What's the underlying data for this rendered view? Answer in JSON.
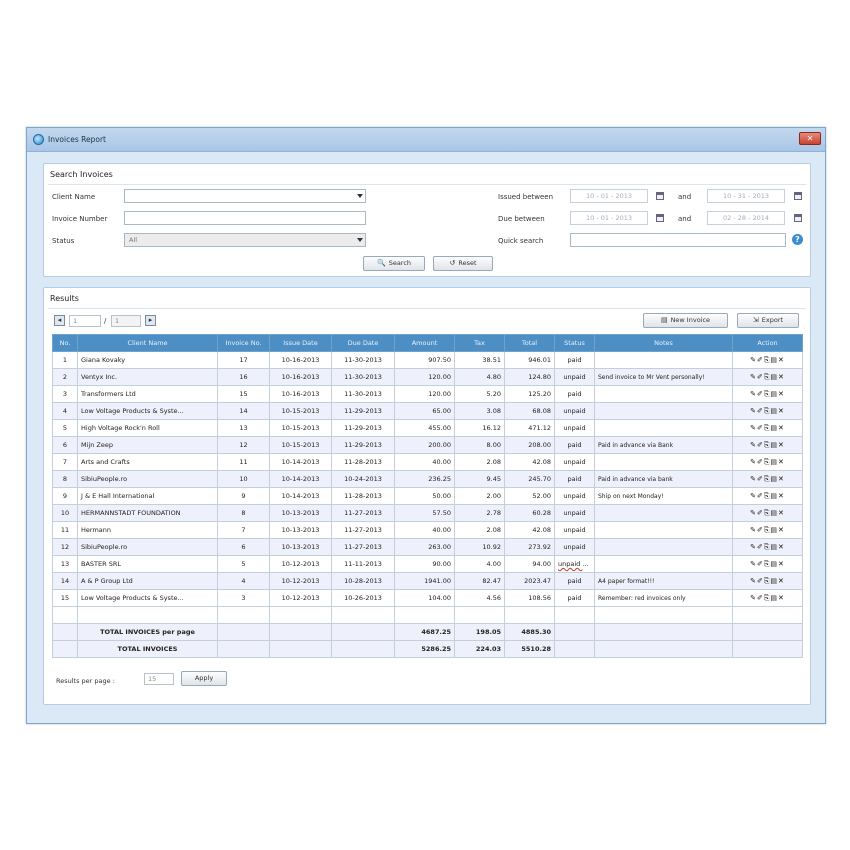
{
  "window": {
    "title": "Invoices Report",
    "close_glyph": "✕"
  },
  "search": {
    "title": "Search Invoices",
    "client_name_label": "Client Name",
    "client_name_value": "",
    "invoice_number_label": "Invoice Number",
    "invoice_number_value": "",
    "status_label": "Status",
    "status_value": "All",
    "issued_between_label": "Issued between",
    "issued_from": "10 - 01 - 2013",
    "issued_to": "10 - 31 - 2013",
    "due_between_label": "Due between",
    "due_from": "10 - 01 - 2013",
    "due_to": "02 - 28 - 2014",
    "and_label": "and",
    "quick_search_label": "Quick search",
    "quick_search_value": "",
    "search_button": "Search",
    "reset_button": "Reset"
  },
  "results": {
    "title": "Results",
    "current_page": "1",
    "total_pages": "1",
    "page_separator": "/",
    "new_invoice_button": "New Invoice",
    "export_button": "Export",
    "columns": [
      "No.",
      "Client Name",
      "Invoice No.",
      "Issue Date",
      "Due Date",
      "Amount",
      "Tax",
      "Total",
      "Status",
      "Notes",
      "Action"
    ],
    "rows": [
      {
        "no": "1",
        "client": "Giana Kovaky",
        "invoice_no": "17",
        "issue_date": "10-16-2013",
        "due_date": "11-30-2013",
        "amount": "907.50",
        "tax": "38.51",
        "total": "946.01",
        "status": "paid",
        "notes": ""
      },
      {
        "no": "2",
        "client": "Ventyx Inc.",
        "invoice_no": "16",
        "issue_date": "10-16-2013",
        "due_date": "11-30-2013",
        "amount": "120.00",
        "tax": "4.80",
        "total": "124.80",
        "status": "unpaid",
        "notes": "Send invoice to Mr Vent personally!"
      },
      {
        "no": "3",
        "client": "Transformers Ltd",
        "invoice_no": "15",
        "issue_date": "10-16-2013",
        "due_date": "11-30-2013",
        "amount": "120.00",
        "tax": "5.20",
        "total": "125.20",
        "status": "paid",
        "notes": ""
      },
      {
        "no": "4",
        "client": "Low Voltage Products & Syste...",
        "invoice_no": "14",
        "issue_date": "10-15-2013",
        "due_date": "11-29-2013",
        "amount": "65.00",
        "tax": "3.08",
        "total": "68.08",
        "status": "unpaid",
        "notes": ""
      },
      {
        "no": "5",
        "client": "High Voltage Rock'n Roll",
        "invoice_no": "13",
        "issue_date": "10-15-2013",
        "due_date": "11-29-2013",
        "amount": "455.00",
        "tax": "16.12",
        "total": "471.12",
        "status": "unpaid",
        "notes": ""
      },
      {
        "no": "6",
        "client": "Mijn Zeep",
        "invoice_no": "12",
        "issue_date": "10-15-2013",
        "due_date": "11-29-2013",
        "amount": "200.00",
        "tax": "8.00",
        "total": "208.00",
        "status": "paid",
        "notes": "Paid in advance via Bank"
      },
      {
        "no": "7",
        "client": "Arts and Crafts",
        "invoice_no": "11",
        "issue_date": "10-14-2013",
        "due_date": "11-28-2013",
        "amount": "40.00",
        "tax": "2.08",
        "total": "42.08",
        "status": "unpaid",
        "notes": ""
      },
      {
        "no": "8",
        "client": "SibiuPeople.ro",
        "invoice_no": "10",
        "issue_date": "10-14-2013",
        "due_date": "10-24-2013",
        "amount": "236.25",
        "tax": "9.45",
        "total": "245.70",
        "status": "paid",
        "notes": "Paid in advance via bank"
      },
      {
        "no": "9",
        "client": "J & E Hall International",
        "invoice_no": "9",
        "issue_date": "10-14-2013",
        "due_date": "11-28-2013",
        "amount": "50.00",
        "tax": "2.00",
        "total": "52.00",
        "status": "unpaid",
        "notes": "Ship on next Monday!"
      },
      {
        "no": "10",
        "client": "HERMANNSTADT FOUNDATION",
        "invoice_no": "8",
        "issue_date": "10-13-2013",
        "due_date": "11-27-2013",
        "amount": "57.50",
        "tax": "2.78",
        "total": "60.28",
        "status": "unpaid",
        "notes": ""
      },
      {
        "no": "11",
        "client": "Hermann",
        "invoice_no": "7",
        "issue_date": "10-13-2013",
        "due_date": "11-27-2013",
        "amount": "40.00",
        "tax": "2.08",
        "total": "42.08",
        "status": "unpaid",
        "notes": ""
      },
      {
        "no": "12",
        "client": "SibiuPeople.ro",
        "invoice_no": "6",
        "issue_date": "10-13-2013",
        "due_date": "11-27-2013",
        "amount": "263.00",
        "tax": "10.92",
        "total": "273.92",
        "status": "unpaid",
        "notes": ""
      },
      {
        "no": "13",
        "client": "BASTER SRL",
        "invoice_no": "5",
        "issue_date": "10-12-2013",
        "due_date": "11-11-2013",
        "amount": "90.00",
        "tax": "4.00",
        "total": "94.00",
        "status": "unpaid overdue",
        "notes": ""
      },
      {
        "no": "14",
        "client": "A & P Group Ltd",
        "invoice_no": "4",
        "issue_date": "10-12-2013",
        "due_date": "10-28-2013",
        "amount": "1941.00",
        "tax": "82.47",
        "total": "2023.47",
        "status": "paid",
        "notes": "A4 paper format!!!"
      },
      {
        "no": "15",
        "client": "Low Voltage Products & Syste...",
        "invoice_no": "3",
        "issue_date": "10-12-2013",
        "due_date": "10-26-2013",
        "amount": "104.00",
        "tax": "4.56",
        "total": "108.56",
        "status": "paid",
        "notes": "Remember: red invoices only"
      }
    ],
    "totals_page": {
      "label": "TOTAL INVOICES per page",
      "amount": "4687.25",
      "tax": "198.05",
      "total": "4885.30"
    },
    "totals_all": {
      "label": "TOTAL INVOICES",
      "amount": "5286.25",
      "tax": "224.03",
      "total": "5510.28"
    },
    "results_per_page_label": "Results per page :",
    "results_per_page_value": "15",
    "apply_button": "Apply"
  }
}
